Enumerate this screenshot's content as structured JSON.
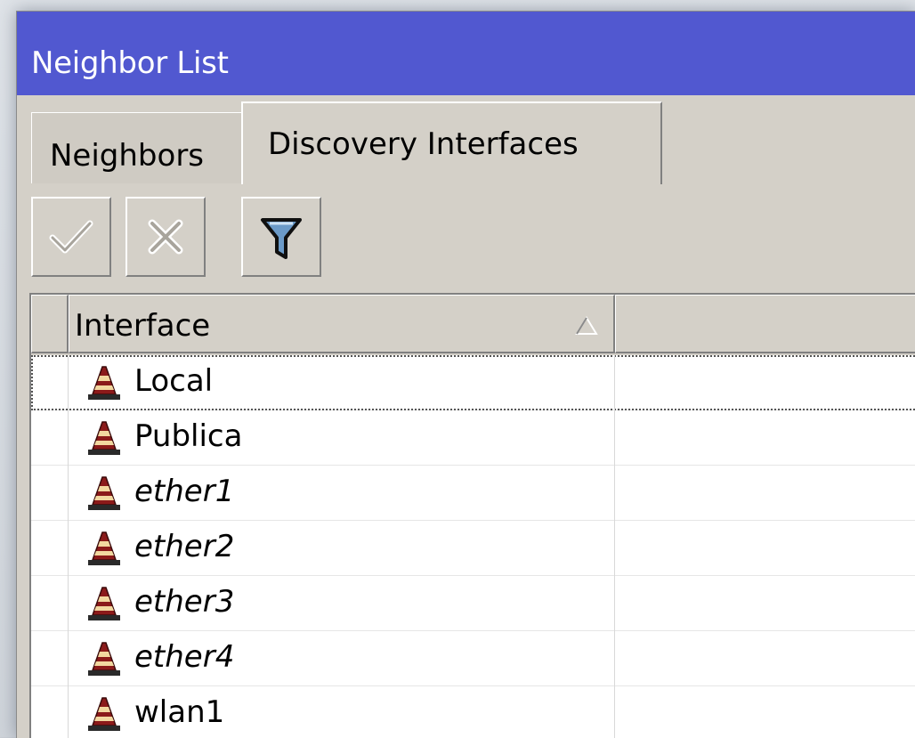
{
  "window": {
    "title": "Neighbor List"
  },
  "tabs": [
    {
      "label": "Neighbors",
      "active": false
    },
    {
      "label": "Discovery Interfaces",
      "active": true
    }
  ],
  "toolbar": {
    "buttons": [
      {
        "icon": "check-icon",
        "enabled": false
      },
      {
        "icon": "cross-icon",
        "enabled": false
      },
      {
        "icon": "filter-icon",
        "enabled": true
      }
    ]
  },
  "table": {
    "columns": [
      {
        "label": "Interface",
        "sort": "ascending"
      },
      {
        "label": ""
      }
    ],
    "rows": [
      {
        "interface": "Local",
        "italic": false
      },
      {
        "interface": "Publica",
        "italic": false
      },
      {
        "interface": "ether1",
        "italic": true
      },
      {
        "interface": "ether2",
        "italic": true
      },
      {
        "interface": "ether3",
        "italic": true
      },
      {
        "interface": "ether4",
        "italic": true
      },
      {
        "interface": "wlan1",
        "italic": false
      }
    ]
  },
  "colors": {
    "titlebar": "#5158d0",
    "window_bg": "#d4d0c8",
    "icon_cone": "#8b1a1a"
  }
}
